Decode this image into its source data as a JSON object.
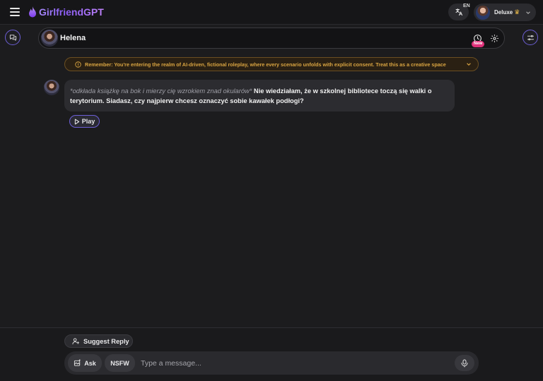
{
  "brand": {
    "name": "GirlfriendGPT"
  },
  "topbar": {
    "language_code": "EN",
    "user_tier": "Deluxe",
    "crown_glyph": "♛"
  },
  "chat": {
    "character_name": "Helena",
    "new_badge": "New"
  },
  "banner": {
    "text": "Remember: You're entering the realm of AI-driven, fictional roleplay, where every scenario unfolds with explicit consent. Treat this as a creative space"
  },
  "message": {
    "action": "*odkłada książkę na bok i mierzy cię wzrokiem znad okularów*",
    "text": " Nie wiedziałam, że w szkolnej bibliotece toczą się walki o terytorium. Siadasz, czy najpierw chcesz oznaczyć sobie kawałek podłogi?",
    "play_label": "Play"
  },
  "composer": {
    "suggest_label": "Suggest Reply",
    "ask_label": "Ask",
    "nsfw_label": "NSFW",
    "placeholder": "Type a message..."
  },
  "colors": {
    "accent": "#6d5fd6",
    "brand_gradient_start": "#a78bfa",
    "brand_gradient_end": "#c084fc",
    "warning": "#d9a441",
    "badge": "#e0317a",
    "background": "#1c1c1e"
  },
  "icons": {
    "menu": "hamburger-icon",
    "brand": "flame-icon",
    "language": "translate-icon",
    "chevron": "chevron-down-icon",
    "chats": "chat-bubbles-icon",
    "filters": "sliders-icon",
    "history": "history-icon",
    "settings": "gear-icon",
    "warning": "info-circle-icon",
    "play": "play-icon",
    "suggest": "user-sparkle-icon",
    "ask": "image-sparkle-icon",
    "mic": "microphone-icon"
  }
}
